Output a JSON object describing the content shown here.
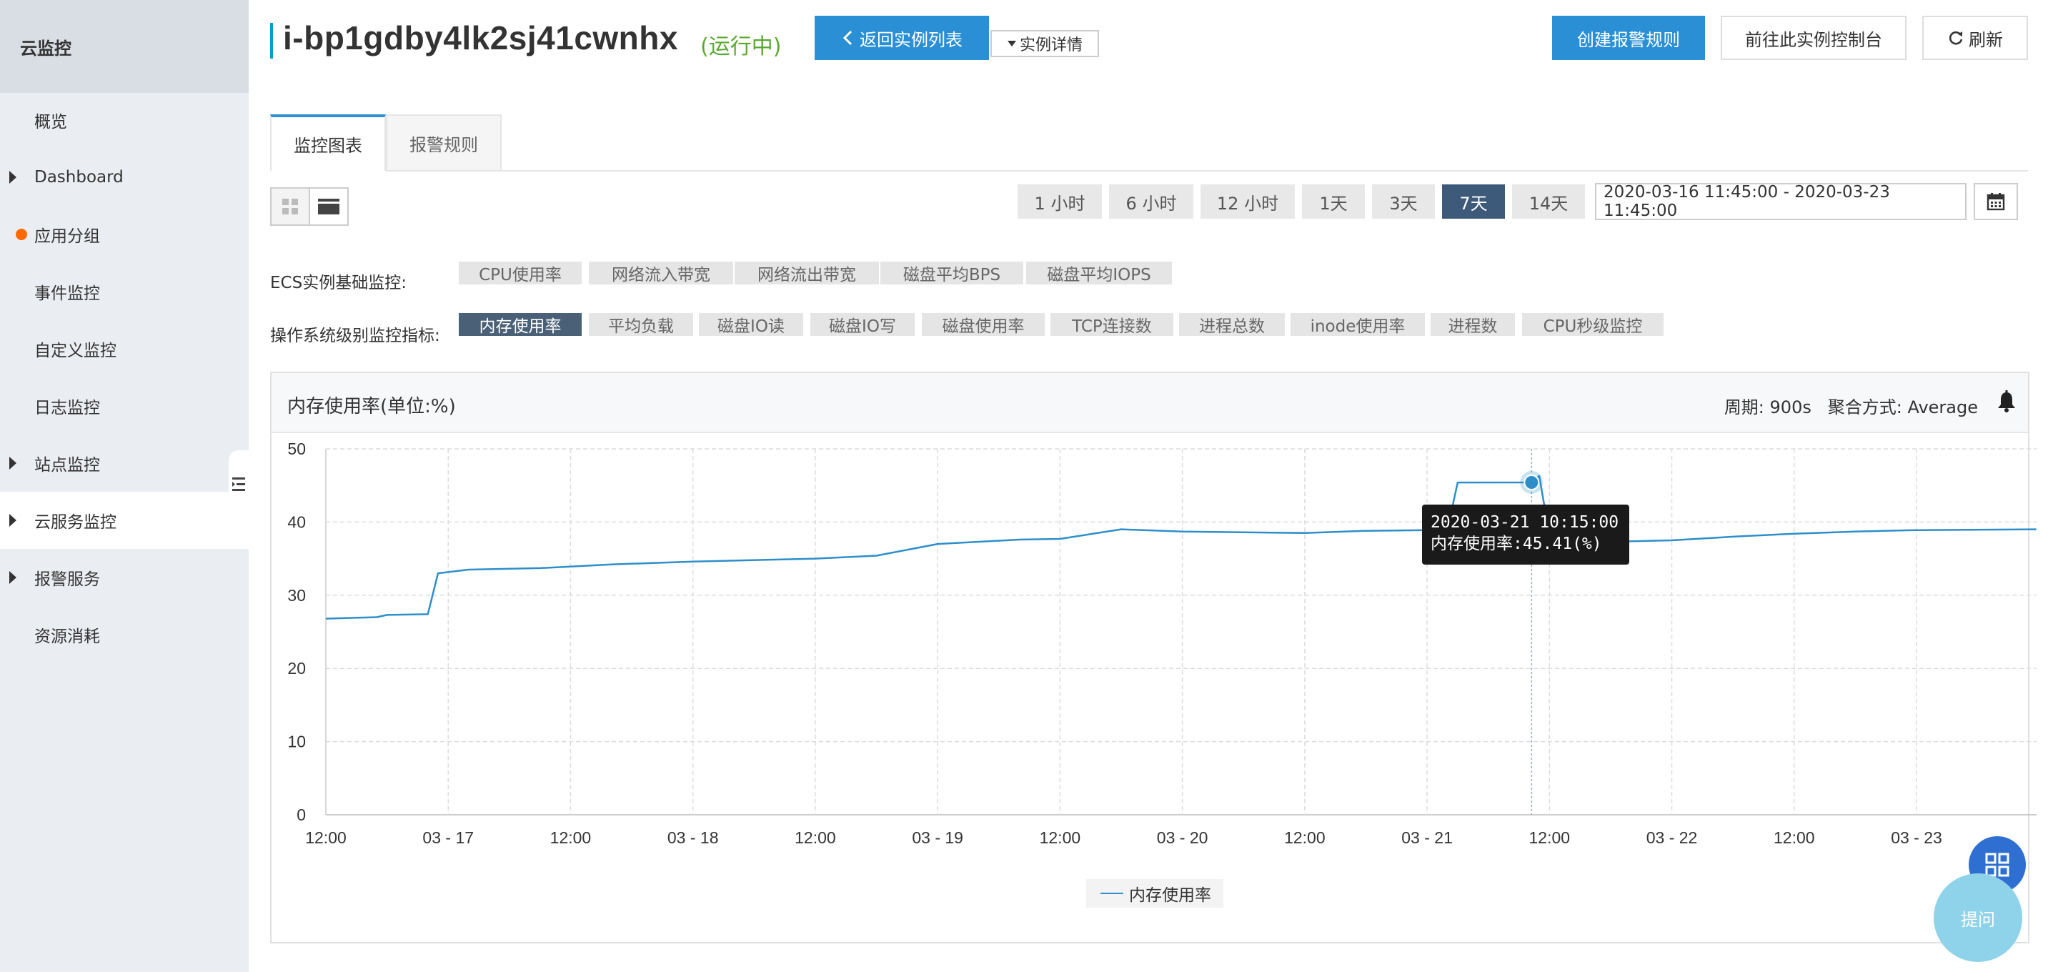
{
  "sidebar": {
    "title": "云监控",
    "items": [
      {
        "label": "概览"
      },
      {
        "label": "Dashboard"
      },
      {
        "label": "应用分组"
      },
      {
        "label": "事件监控"
      },
      {
        "label": "自定义监控"
      },
      {
        "label": "日志监控"
      },
      {
        "label": "站点监控"
      },
      {
        "label": "云服务监控"
      },
      {
        "label": "报警服务"
      },
      {
        "label": "资源消耗"
      }
    ]
  },
  "header": {
    "instance_id": "i-bp1gdby4lk2sj41cwnhx",
    "status": "(运行中)",
    "back_label": "返回实例列表",
    "detail_label": "实例详情",
    "create_alarm_label": "创建报警规则",
    "console_label": "前往此实例控制台",
    "refresh_label": "刷新"
  },
  "tabs": [
    {
      "label": "监控图表"
    },
    {
      "label": "报警规则"
    }
  ],
  "time_ranges": [
    "1 小时",
    "6 小时",
    "12 小时",
    "1天",
    "3天",
    "7天",
    "14天"
  ],
  "selected_range": "7天",
  "date_range": "2020-03-16 11:45:00 - 2020-03-23 11:45:00",
  "metric_rows": {
    "basic_label": "ECS实例基础监控:",
    "basic": [
      "CPU使用率",
      "网络流入带宽",
      "网络流出带宽",
      "磁盘平均BPS",
      "磁盘平均IOPS"
    ],
    "os_label": "操作系统级别监控指标:",
    "os": [
      "内存使用率",
      "平均负载",
      "磁盘IO读",
      "磁盘IO写",
      "磁盘使用率",
      "TCP连接数",
      "进程总数",
      "inode使用率",
      "进程数",
      "CPU秒级监控"
    ],
    "os_selected": "内存使用率"
  },
  "panel": {
    "title": "内存使用率(单位:%)",
    "period": "周期: 900s   聚合方式: Average"
  },
  "tooltip": {
    "time": "2020-03-21 10:15:00",
    "value": "内存使用率:45.41(%)"
  },
  "chart_data": {
    "type": "line",
    "x_ticks": [
      "12:00",
      "03 - 17",
      "12:00",
      "03 - 18",
      "12:00",
      "03 - 19",
      "12:00",
      "03 - 20",
      "12:00",
      "03 - 21",
      "12:00",
      "03 - 22",
      "12:00",
      "03 - 23"
    ],
    "ylim": [
      0,
      50
    ],
    "y_ticks": [
      0,
      10,
      20,
      30,
      40,
      50
    ],
    "grid": true,
    "legend": "bottom",
    "series": [
      {
        "name": "内存使用率",
        "color": "#2d8ec9",
        "x": [
          "2020-03-16 12:00",
          "2020-03-16 17:00",
          "2020-03-16 18:00",
          "2020-03-16 22:00",
          "2020-03-16 23:00",
          "2020-03-17 02:00",
          "2020-03-17 09:00",
          "2020-03-17 16:00",
          "2020-03-18 00:00",
          "2020-03-18 12:00",
          "2020-03-18 18:00",
          "2020-03-19 00:00",
          "2020-03-19 08:00",
          "2020-03-19 12:00",
          "2020-03-19 18:00",
          "2020-03-20 00:00",
          "2020-03-20 12:00",
          "2020-03-20 18:00",
          "2020-03-21 00:00",
          "2020-03-21 02:00",
          "2020-03-21 03:00",
          "2020-03-21 10:15",
          "2020-03-21 11:00",
          "2020-03-21 12:00",
          "2020-03-21 18:00",
          "2020-03-22 00:00",
          "2020-03-22 06:00",
          "2020-03-22 12:00",
          "2020-03-22 18:00",
          "2020-03-23 00:00",
          "2020-03-23 11:45"
        ],
        "values": [
          26.8,
          27.0,
          27.3,
          27.4,
          33.0,
          33.5,
          33.7,
          34.2,
          34.6,
          35.0,
          35.4,
          37.0,
          37.6,
          37.7,
          39.0,
          38.7,
          38.5,
          38.8,
          38.9,
          39.0,
          45.4,
          45.41,
          46.3,
          38.2,
          37.3,
          37.5,
          38.0,
          38.4,
          38.7,
          38.9,
          39.0
        ]
      }
    ]
  },
  "float": {
    "ask_label": "提问"
  }
}
